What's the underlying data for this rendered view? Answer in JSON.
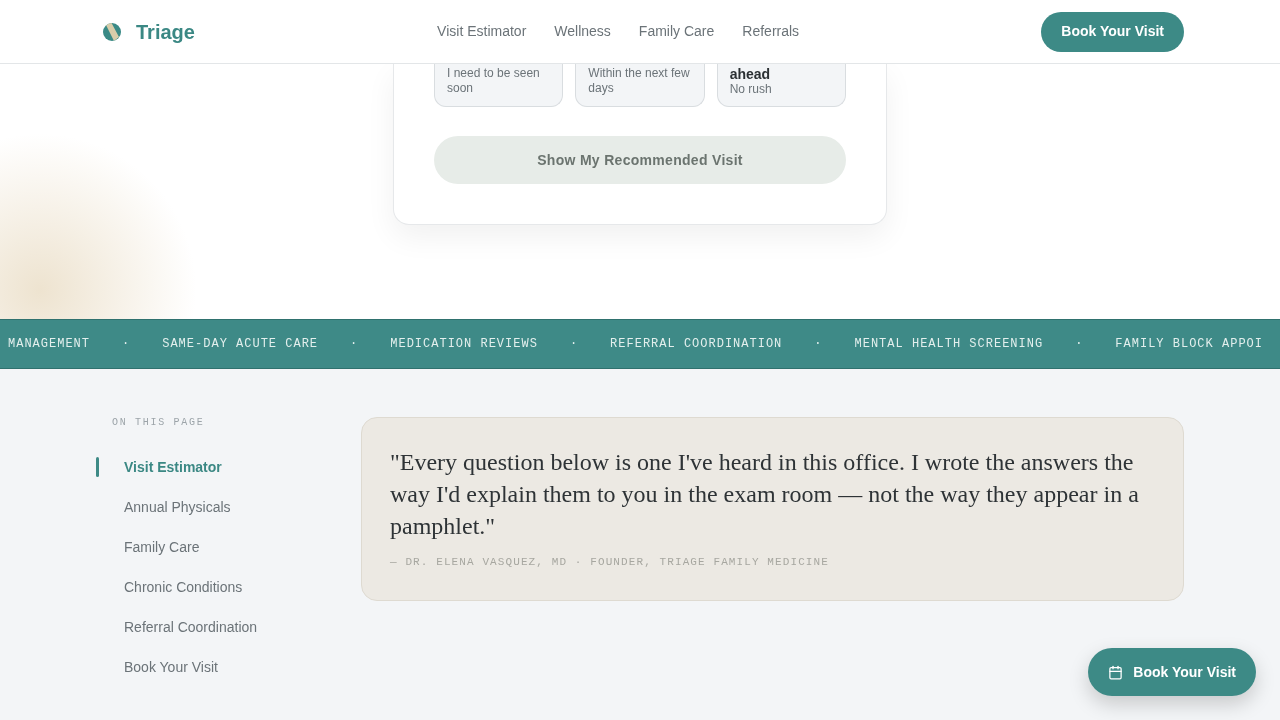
{
  "header": {
    "brand": "Triage",
    "nav": [
      {
        "label": "Visit Estimator"
      },
      {
        "label": "Wellness"
      },
      {
        "label": "Family Care"
      },
      {
        "label": "Referrals"
      }
    ],
    "cta": "Book Your Visit"
  },
  "estimator": {
    "options": [
      {
        "description": "I need to be seen soon",
        "selected": false
      },
      {
        "description": "Within the next few days",
        "selected": false
      },
      {
        "title": "ahead",
        "description": "No rush",
        "selected": false
      }
    ],
    "submit": {
      "label": "Show My Recommended Visit",
      "disabled": true
    }
  },
  "ticker": [
    {
      "label": "MANAGEMENT",
      "separator": "·"
    },
    {
      "label": "SAME-DAY ACUTE CARE",
      "separator": "·"
    },
    {
      "label": "MEDICATION REVIEWS",
      "separator": "·"
    },
    {
      "label": "REFERRAL COORDINATION",
      "separator": "·"
    },
    {
      "label": "MENTAL HEALTH SCREENING",
      "separator": "·"
    },
    {
      "label": "FAMILY BLOCK APPOI"
    }
  ],
  "sidebar": {
    "heading": "ON THIS PAGE",
    "items": [
      {
        "label": "Visit Estimator",
        "selected": true
      },
      {
        "label": "Annual Physicals",
        "selected": false
      },
      {
        "label": "Family Care",
        "selected": false
      },
      {
        "label": "Chronic Conditions",
        "selected": false
      },
      {
        "label": "Referral Coordination",
        "selected": false
      },
      {
        "label": "Book Your Visit",
        "selected": false
      }
    ]
  },
  "quote": {
    "text": "\"Every question below is one I've heard in this office. I wrote the answers the way I'd explain them to you in the exam room — not the way they appear in a pamphlet.\"",
    "attribution": "— DR. ELENA VASQUEZ, MD · FOUNDER, TRIAGE FAMILY MEDICINE"
  },
  "floating_button": {
    "label": "Book Your Visit"
  }
}
